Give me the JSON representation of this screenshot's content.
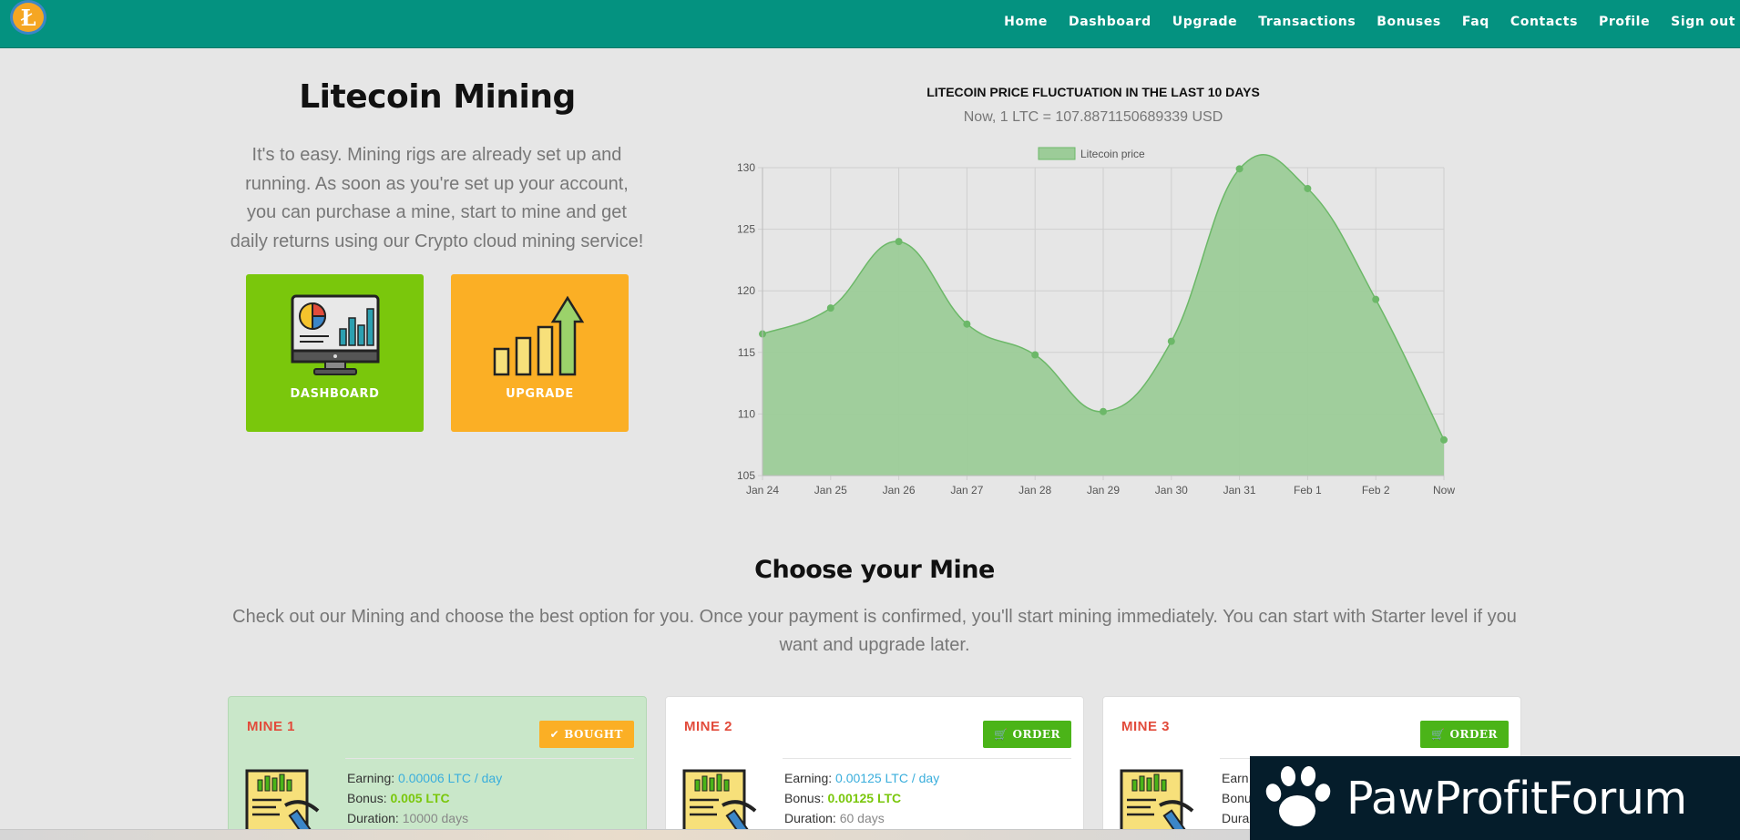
{
  "nav": {
    "logo_letter": "Ł",
    "items": [
      "Home",
      "Dashboard",
      "Upgrade",
      "Transactions",
      "Bonuses",
      "Faq",
      "Contacts",
      "Profile",
      "Sign out"
    ]
  },
  "hero": {
    "title": "Litecoin Mining",
    "text": "It's to easy. Mining rigs are already set up and running. As soon as you're set up your account, you can purchase a mine, start to mine and get daily returns using our Crypto cloud mining service!",
    "tiles": {
      "dashboard": "DASHBOARD",
      "upgrade": "UPGRADE"
    }
  },
  "chart_header": {
    "title": "LITECOIN PRICE FLUCTUATION IN THE LAST 10 DAYS",
    "subtitle": "Now, 1 LTC = 107.8871150689339 USD"
  },
  "chart_data": {
    "type": "area",
    "categories": [
      "Jan 24",
      "Jan 25",
      "Jan 26",
      "Jan 27",
      "Jan 28",
      "Jan 29",
      "Jan 30",
      "Jan 31",
      "Feb 1",
      "Feb 2",
      "Now"
    ],
    "series": [
      {
        "name": "Litecoin price",
        "values": [
          116.5,
          118.6,
          124.0,
          117.3,
          114.8,
          110.2,
          115.9,
          129.9,
          128.3,
          119.3,
          107.9
        ]
      }
    ],
    "ylim": [
      105,
      130
    ],
    "yticks": [
      105,
      110,
      115,
      120,
      125,
      130
    ],
    "grid": true,
    "legend": "top-center",
    "colors": {
      "fill": "#9ccc98",
      "line": "#6cb868"
    }
  },
  "choose": {
    "title": "Choose your Mine",
    "text": "Check out our Mining and choose the best option for you. Once your payment is confirmed, you'll start mining immediately. You can start with Starter level if you want and upgrade later."
  },
  "cards": [
    {
      "name": "MINE 1",
      "button": "BOUGHT",
      "button_icon": "check-icon",
      "earning_label": "Earning:",
      "earning": "0.00006 LTC / day",
      "bonus_label": "Bonus:",
      "bonus": "0.005 LTC",
      "duration_label": "Duration:",
      "duration": "10000 days"
    },
    {
      "name": "MINE 2",
      "button": "ORDER",
      "button_icon": "cart-icon",
      "earning_label": "Earning:",
      "earning": "0.00125 LTC / day",
      "bonus_label": "Bonus:",
      "bonus": "0.00125 LTC",
      "duration_label": "Duration:",
      "duration": "60 days"
    },
    {
      "name": "MINE 3",
      "button": "ORDER",
      "button_icon": "cart-icon",
      "earning_label": "Earn",
      "earning": "",
      "bonus_label": "Bonu",
      "bonus": "",
      "duration_label": "Dura",
      "duration": ""
    }
  ],
  "watermark": {
    "text": "PawProfitForum"
  }
}
